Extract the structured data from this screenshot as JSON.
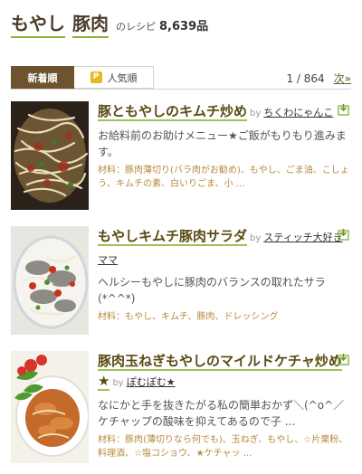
{
  "header": {
    "keyword1": "もやし",
    "keyword2": "豚肉",
    "suffix": "のレシピ",
    "count": "8,639品"
  },
  "tabs": {
    "new": "新着順",
    "popular_icon": "P",
    "popular": "人気順"
  },
  "pager": {
    "text": "1 / 864",
    "next": "次»"
  },
  "recipes": [
    {
      "title": "豚ともやしのキムチ炒め",
      "by": "by",
      "author": "ちくわにゃんこ",
      "description": "お給料前のお助けメニュー★ご飯がもりもり進みます。",
      "ingredients": "材料：豚肉薄切り(バラ肉がお勧め)、もやし、ごま油、こしょう、キムチの素、白いりごま、小 ..."
    },
    {
      "title": "もやしキムチ豚肉サラダ",
      "by": "by",
      "author": "スティッチ大好きママ",
      "description": "ヘルシーもやしに豚肉のバランスの取れたサラ(*^^*)",
      "ingredients": "材料：もやし、キムチ、豚肉、ドレッシング"
    },
    {
      "title": "豚肉玉ねぎもやしのマイルドケチャ炒め★",
      "by": "by",
      "author": "ぽむぽむ★",
      "description": "なにかと手を抜きたがる私の簡単おかず＼(^o^／ケチャップの酸味を抑えてあるので子 ...",
      "ingredients": "材料：豚肉(薄切りなら何でも)、玉ねぎ、もやし、☆片栗粉、料理酒、☆塩コショウ、★ケチャッ ..."
    }
  ]
}
